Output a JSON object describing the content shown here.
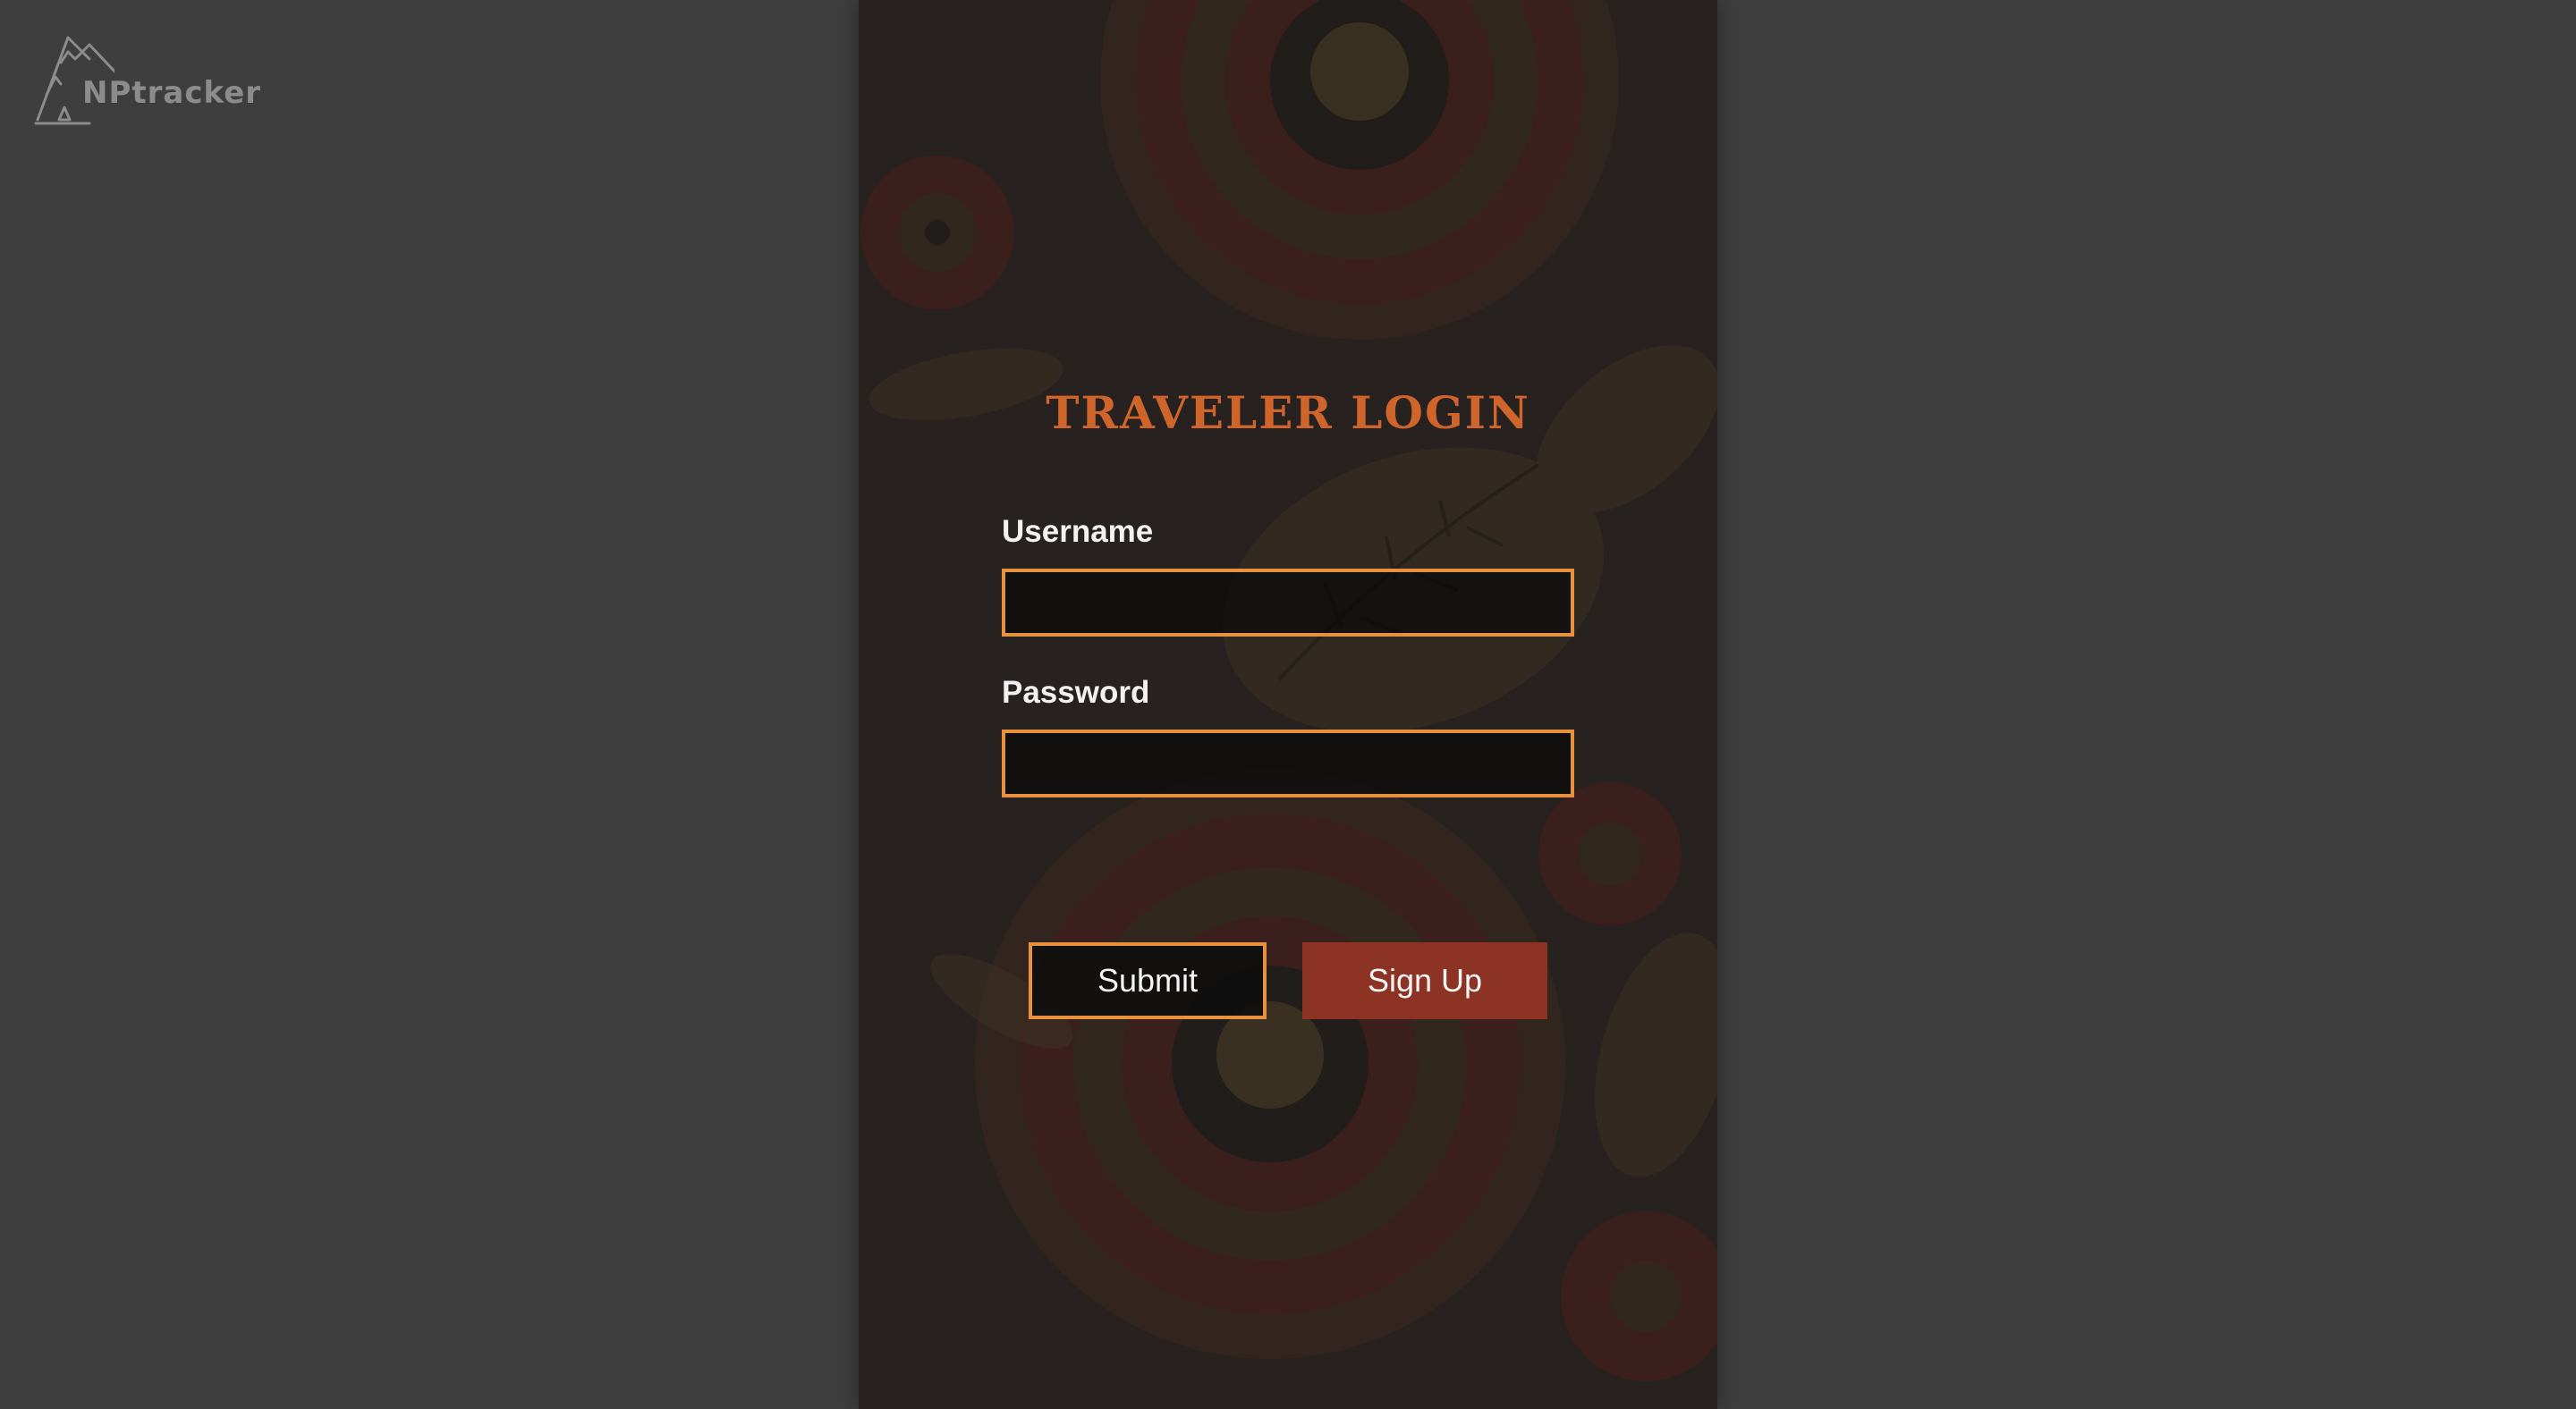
{
  "brand": {
    "logo_text": "NPtracker",
    "logo_icon": "mountain-tent-icon"
  },
  "login": {
    "title": "TRAVELER LOGIN",
    "username_label": "Username",
    "username_value": "",
    "password_label": "Password",
    "password_value": "",
    "submit_label": "Submit",
    "signup_label": "Sign Up"
  },
  "colors": {
    "page_background": "#3e3e3e",
    "panel_background": "#27211f",
    "accent_orange": "#e8913e",
    "title_orange": "#d0652c",
    "signup_red": "#8c3324",
    "logo_gray": "#8c8c8c"
  }
}
